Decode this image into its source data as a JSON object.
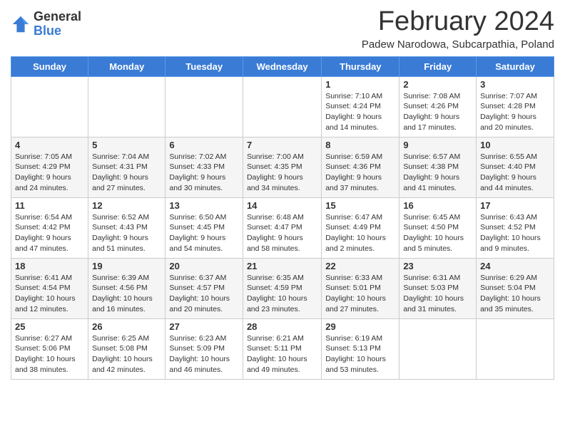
{
  "header": {
    "logo_general": "General",
    "logo_blue": "Blue",
    "month_year": "February 2024",
    "location": "Padew Narodowa, Subcarpathia, Poland"
  },
  "weekdays": [
    "Sunday",
    "Monday",
    "Tuesday",
    "Wednesday",
    "Thursday",
    "Friday",
    "Saturday"
  ],
  "weeks": [
    [
      {
        "day": "",
        "info": ""
      },
      {
        "day": "",
        "info": ""
      },
      {
        "day": "",
        "info": ""
      },
      {
        "day": "",
        "info": ""
      },
      {
        "day": "1",
        "info": "Sunrise: 7:10 AM\nSunset: 4:24 PM\nDaylight: 9 hours\nand 14 minutes."
      },
      {
        "day": "2",
        "info": "Sunrise: 7:08 AM\nSunset: 4:26 PM\nDaylight: 9 hours\nand 17 minutes."
      },
      {
        "day": "3",
        "info": "Sunrise: 7:07 AM\nSunset: 4:28 PM\nDaylight: 9 hours\nand 20 minutes."
      }
    ],
    [
      {
        "day": "4",
        "info": "Sunrise: 7:05 AM\nSunset: 4:29 PM\nDaylight: 9 hours\nand 24 minutes."
      },
      {
        "day": "5",
        "info": "Sunrise: 7:04 AM\nSunset: 4:31 PM\nDaylight: 9 hours\nand 27 minutes."
      },
      {
        "day": "6",
        "info": "Sunrise: 7:02 AM\nSunset: 4:33 PM\nDaylight: 9 hours\nand 30 minutes."
      },
      {
        "day": "7",
        "info": "Sunrise: 7:00 AM\nSunset: 4:35 PM\nDaylight: 9 hours\nand 34 minutes."
      },
      {
        "day": "8",
        "info": "Sunrise: 6:59 AM\nSunset: 4:36 PM\nDaylight: 9 hours\nand 37 minutes."
      },
      {
        "day": "9",
        "info": "Sunrise: 6:57 AM\nSunset: 4:38 PM\nDaylight: 9 hours\nand 41 minutes."
      },
      {
        "day": "10",
        "info": "Sunrise: 6:55 AM\nSunset: 4:40 PM\nDaylight: 9 hours\nand 44 minutes."
      }
    ],
    [
      {
        "day": "11",
        "info": "Sunrise: 6:54 AM\nSunset: 4:42 PM\nDaylight: 9 hours\nand 47 minutes."
      },
      {
        "day": "12",
        "info": "Sunrise: 6:52 AM\nSunset: 4:43 PM\nDaylight: 9 hours\nand 51 minutes."
      },
      {
        "day": "13",
        "info": "Sunrise: 6:50 AM\nSunset: 4:45 PM\nDaylight: 9 hours\nand 54 minutes."
      },
      {
        "day": "14",
        "info": "Sunrise: 6:48 AM\nSunset: 4:47 PM\nDaylight: 9 hours\nand 58 minutes."
      },
      {
        "day": "15",
        "info": "Sunrise: 6:47 AM\nSunset: 4:49 PM\nDaylight: 10 hours\nand 2 minutes."
      },
      {
        "day": "16",
        "info": "Sunrise: 6:45 AM\nSunset: 4:50 PM\nDaylight: 10 hours\nand 5 minutes."
      },
      {
        "day": "17",
        "info": "Sunrise: 6:43 AM\nSunset: 4:52 PM\nDaylight: 10 hours\nand 9 minutes."
      }
    ],
    [
      {
        "day": "18",
        "info": "Sunrise: 6:41 AM\nSunset: 4:54 PM\nDaylight: 10 hours\nand 12 minutes."
      },
      {
        "day": "19",
        "info": "Sunrise: 6:39 AM\nSunset: 4:56 PM\nDaylight: 10 hours\nand 16 minutes."
      },
      {
        "day": "20",
        "info": "Sunrise: 6:37 AM\nSunset: 4:57 PM\nDaylight: 10 hours\nand 20 minutes."
      },
      {
        "day": "21",
        "info": "Sunrise: 6:35 AM\nSunset: 4:59 PM\nDaylight: 10 hours\nand 23 minutes."
      },
      {
        "day": "22",
        "info": "Sunrise: 6:33 AM\nSunset: 5:01 PM\nDaylight: 10 hours\nand 27 minutes."
      },
      {
        "day": "23",
        "info": "Sunrise: 6:31 AM\nSunset: 5:03 PM\nDaylight: 10 hours\nand 31 minutes."
      },
      {
        "day": "24",
        "info": "Sunrise: 6:29 AM\nSunset: 5:04 PM\nDaylight: 10 hours\nand 35 minutes."
      }
    ],
    [
      {
        "day": "25",
        "info": "Sunrise: 6:27 AM\nSunset: 5:06 PM\nDaylight: 10 hours\nand 38 minutes."
      },
      {
        "day": "26",
        "info": "Sunrise: 6:25 AM\nSunset: 5:08 PM\nDaylight: 10 hours\nand 42 minutes."
      },
      {
        "day": "27",
        "info": "Sunrise: 6:23 AM\nSunset: 5:09 PM\nDaylight: 10 hours\nand 46 minutes."
      },
      {
        "day": "28",
        "info": "Sunrise: 6:21 AM\nSunset: 5:11 PM\nDaylight: 10 hours\nand 49 minutes."
      },
      {
        "day": "29",
        "info": "Sunrise: 6:19 AM\nSunset: 5:13 PM\nDaylight: 10 hours\nand 53 minutes."
      },
      {
        "day": "",
        "info": ""
      },
      {
        "day": "",
        "info": ""
      }
    ]
  ]
}
